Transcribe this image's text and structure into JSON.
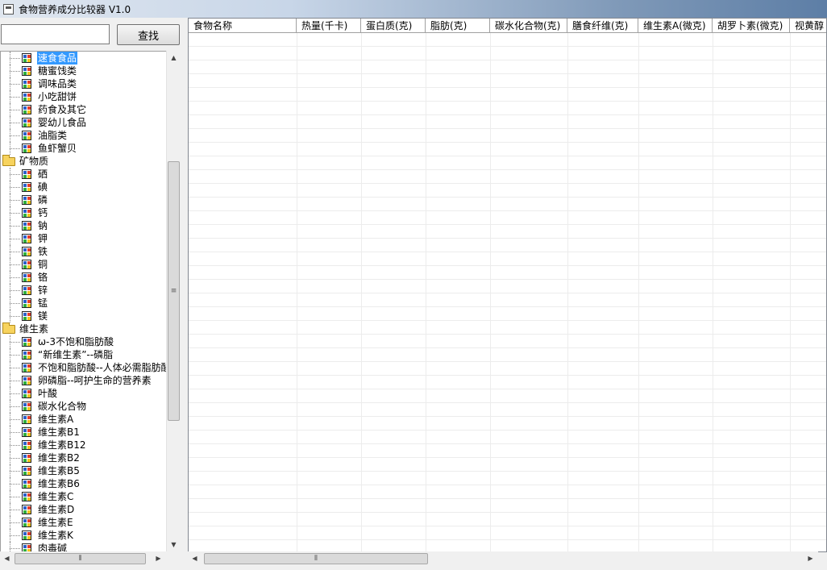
{
  "window": {
    "title": "食物营养成分比较器 V1.0"
  },
  "search": {
    "value": "",
    "placeholder": "",
    "button_label": "查找"
  },
  "tree": {
    "items": [
      {
        "label": "速食食品",
        "type": "leaf",
        "selected": true
      },
      {
        "label": "糖蜜饯类",
        "type": "leaf"
      },
      {
        "label": "调味品类",
        "type": "leaf"
      },
      {
        "label": "小吃甜饼",
        "type": "leaf"
      },
      {
        "label": "药食及其它",
        "type": "leaf"
      },
      {
        "label": "婴幼儿食品",
        "type": "leaf"
      },
      {
        "label": "油脂类",
        "type": "leaf"
      },
      {
        "label": "鱼虾蟹贝",
        "type": "leaf"
      },
      {
        "label": "矿物质",
        "type": "folder"
      },
      {
        "label": "硒",
        "type": "leaf"
      },
      {
        "label": "碘",
        "type": "leaf"
      },
      {
        "label": "磷",
        "type": "leaf"
      },
      {
        "label": "钙",
        "type": "leaf"
      },
      {
        "label": "钠",
        "type": "leaf"
      },
      {
        "label": "钾",
        "type": "leaf"
      },
      {
        "label": "铁",
        "type": "leaf"
      },
      {
        "label": "铜",
        "type": "leaf"
      },
      {
        "label": "铬",
        "type": "leaf"
      },
      {
        "label": "锌",
        "type": "leaf"
      },
      {
        "label": "锰",
        "type": "leaf"
      },
      {
        "label": "镁",
        "type": "leaf"
      },
      {
        "label": "维生素",
        "type": "folder"
      },
      {
        "label": "ω-3不饱和脂肪酸",
        "type": "leaf"
      },
      {
        "label": "“新维生素”--磷脂",
        "type": "leaf"
      },
      {
        "label": "不饱和脂肪酸--人体必需脂肪酸",
        "type": "leaf"
      },
      {
        "label": "卵磷脂--呵护生命的营养素",
        "type": "leaf"
      },
      {
        "label": "叶酸",
        "type": "leaf"
      },
      {
        "label": "碳水化合物",
        "type": "leaf"
      },
      {
        "label": "维生素A",
        "type": "leaf"
      },
      {
        "label": "维生素B1",
        "type": "leaf"
      },
      {
        "label": "维生素B12",
        "type": "leaf"
      },
      {
        "label": "维生素B2",
        "type": "leaf"
      },
      {
        "label": "维生素B5",
        "type": "leaf"
      },
      {
        "label": "维生素B6",
        "type": "leaf"
      },
      {
        "label": "维生素C",
        "type": "leaf"
      },
      {
        "label": "维生素D",
        "type": "leaf"
      },
      {
        "label": "维生素E",
        "type": "leaf"
      },
      {
        "label": "维生素K",
        "type": "leaf"
      },
      {
        "label": "肉毒碱",
        "type": "leaf"
      }
    ]
  },
  "grid": {
    "columns": [
      "食物名称",
      "热量(千卡)",
      "蛋白质(克)",
      "脂肪(克)",
      "碳水化合物(克)",
      "膳食纤维(克)",
      "维生素A(微克)",
      "胡罗卜素(微克)",
      "视黄醇"
    ],
    "rows": []
  },
  "scrollbars": {
    "arrow_up": "▲",
    "arrow_down": "▼",
    "arrow_left": "◀",
    "arrow_right": "▶",
    "grip": "≡",
    "hgrip": "⦀"
  }
}
